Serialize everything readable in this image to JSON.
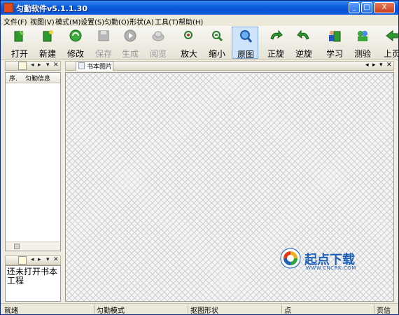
{
  "window": {
    "title": "匀勤软件v5.1.1.30",
    "minimize": "_",
    "maximize": "□",
    "close": "X"
  },
  "menu": [
    {
      "label": "文件(F)"
    },
    {
      "label": "视图(V)"
    },
    {
      "label": "模式(M)"
    },
    {
      "label": "设置(S)"
    },
    {
      "label": "匀勤(O)"
    },
    {
      "label": "形状(A)"
    },
    {
      "label": "工具(T)"
    },
    {
      "label": "帮助(H)"
    }
  ],
  "toolbar": [
    {
      "label": "打开",
      "icon": "open-book-icon",
      "enabled": true
    },
    {
      "label": "新建",
      "icon": "new-book-icon",
      "enabled": true
    },
    {
      "label": "修改",
      "icon": "edit-cycle-icon",
      "enabled": true
    },
    {
      "label": "保存",
      "icon": "save-icon",
      "enabled": false
    },
    {
      "label": "生成",
      "icon": "play-icon",
      "enabled": false
    },
    {
      "label": "阅览",
      "icon": "view-icon",
      "enabled": false
    },
    {
      "label": "放大",
      "icon": "zoom-in-icon",
      "enabled": true
    },
    {
      "label": "缩小",
      "icon": "zoom-out-icon",
      "enabled": true
    },
    {
      "label": "原图",
      "icon": "original-size-icon",
      "enabled": true,
      "active": true
    },
    {
      "label": "正旋",
      "icon": "rotate-cw-icon",
      "enabled": true
    },
    {
      "label": "逆旋",
      "icon": "rotate-ccw-icon",
      "enabled": true
    },
    {
      "label": "学习",
      "icon": "learn-icon",
      "enabled": true
    },
    {
      "label": "测验",
      "icon": "quiz-icon",
      "enabled": true
    },
    {
      "label": "上页",
      "icon": "prev-page-icon",
      "enabled": true
    }
  ],
  "left_panel": {
    "list": {
      "columns": [
        "序.",
        "匀勤信息"
      ]
    },
    "info": {
      "message": "还未打开书本工程"
    }
  },
  "document": {
    "tab_label": "书本图片"
  },
  "watermark": {
    "title": "起点下载",
    "url": "WWW.CNCRK.COM"
  },
  "statusbar": [
    "就绪",
    "匀勤模式",
    "抠图形状",
    "点",
    "页信"
  ],
  "colors": {
    "title_bar": "#0852d0",
    "accent_active": "#cfe3fb",
    "watermark": "#1c5fb8"
  }
}
